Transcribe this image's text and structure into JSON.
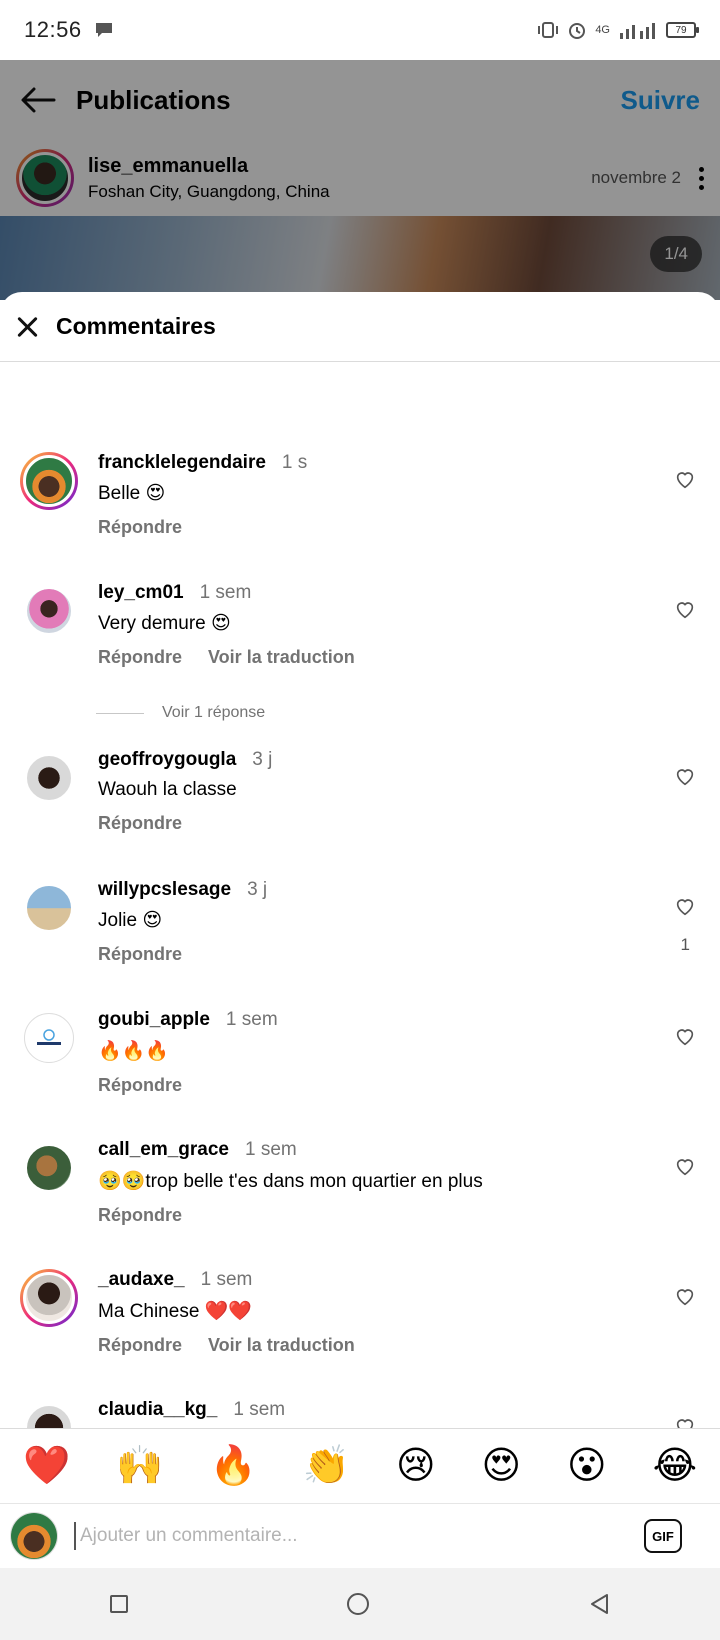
{
  "status_bar": {
    "time": "12:56",
    "battery": "79",
    "network": "4G"
  },
  "post": {
    "header_title": "Publications",
    "follow_label": "Suivre",
    "author_name": "lise_emmanuella",
    "author_location": "Foshan City, Guangdong, China",
    "date": "novembre 2",
    "page_indicator": "1/4"
  },
  "comments_sheet": {
    "title": "Commentaires",
    "reply_label": "Répondre",
    "translate_label": "Voir la traduction",
    "view_replies_label": "Voir 1 réponse",
    "comments": [
      {
        "user": "francklelegendaire",
        "time": "1 s",
        "text": "Belle 😍",
        "likes": "",
        "translate": false
      },
      {
        "user": "ley_cm01",
        "time": "1 sem",
        "text": "Very demure 😍",
        "likes": "",
        "translate": true
      },
      {
        "user": "geoffroygougla",
        "time": "3 j",
        "text": "Waouh la classe",
        "likes": "",
        "translate": false
      },
      {
        "user": "willypcslesage",
        "time": "3 j",
        "text": "Jolie 😍",
        "likes": "1",
        "translate": false
      },
      {
        "user": "goubi_apple",
        "time": "1 sem",
        "text": "🔥🔥🔥",
        "likes": "",
        "translate": false
      },
      {
        "user": "call_em_grace",
        "time": "1 sem",
        "text": "🥹🥹trop belle t'es dans mon quartier en plus",
        "likes": "",
        "translate": false
      },
      {
        "user": "_audaxe_",
        "time": "1 sem",
        "text": "Ma Chinese ❤️❤️",
        "likes": "",
        "translate": true
      },
      {
        "user": "claudia__kg_",
        "time": "1 sem",
        "text": "😍❤️",
        "likes": "",
        "translate": false
      }
    ]
  },
  "emoji_bar": [
    "❤️",
    "🙌",
    "🔥",
    "👏",
    "😢",
    "😍",
    "😮",
    "😂"
  ],
  "input": {
    "placeholder": "Ajouter un commentaire...",
    "gif_label": "GIF"
  },
  "colors": {
    "accent": "#1a9cf0",
    "muted": "#737373",
    "divider": "#dbdbdb"
  }
}
